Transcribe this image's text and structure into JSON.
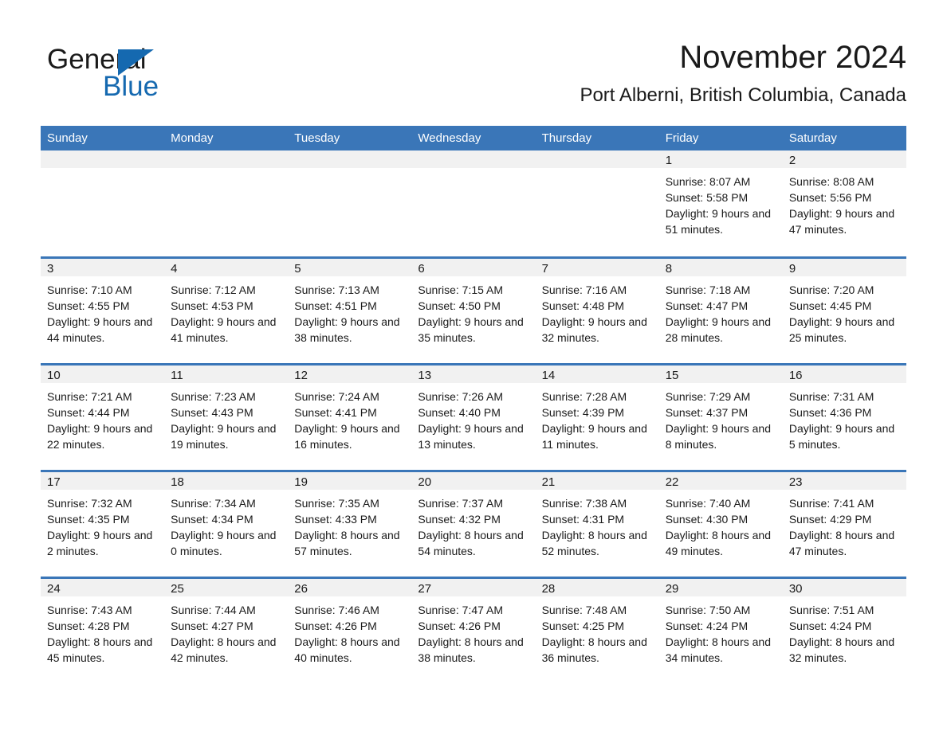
{
  "brand": {
    "word1": "General",
    "word2": "Blue",
    "triangle_color": "#1569b0"
  },
  "header": {
    "title": "November 2024",
    "subtitle": "Port Alberni, British Columbia, Canada"
  },
  "theme": {
    "header_blue": "#3a76b8",
    "daynum_gray": "#f1f1f1",
    "text": "#1a1a1a"
  },
  "weekday_headers": [
    "Sunday",
    "Monday",
    "Tuesday",
    "Wednesday",
    "Thursday",
    "Friday",
    "Saturday"
  ],
  "labels": {
    "sunrise_prefix": "Sunrise:",
    "sunset_prefix": "Sunset:",
    "daylight_prefix": "Daylight:"
  },
  "weeks": [
    [
      {
        "day": "",
        "empty": true
      },
      {
        "day": "",
        "empty": true
      },
      {
        "day": "",
        "empty": true
      },
      {
        "day": "",
        "empty": true
      },
      {
        "day": "",
        "empty": true
      },
      {
        "day": "1",
        "sunrise": "Sunrise: 8:07 AM",
        "sunset": "Sunset: 5:58 PM",
        "daylight": "Daylight: 9 hours and 51 minutes."
      },
      {
        "day": "2",
        "sunrise": "Sunrise: 8:08 AM",
        "sunset": "Sunset: 5:56 PM",
        "daylight": "Daylight: 9 hours and 47 minutes."
      }
    ],
    [
      {
        "day": "3",
        "sunrise": "Sunrise: 7:10 AM",
        "sunset": "Sunset: 4:55 PM",
        "daylight": "Daylight: 9 hours and 44 minutes."
      },
      {
        "day": "4",
        "sunrise": "Sunrise: 7:12 AM",
        "sunset": "Sunset: 4:53 PM",
        "daylight": "Daylight: 9 hours and 41 minutes."
      },
      {
        "day": "5",
        "sunrise": "Sunrise: 7:13 AM",
        "sunset": "Sunset: 4:51 PM",
        "daylight": "Daylight: 9 hours and 38 minutes."
      },
      {
        "day": "6",
        "sunrise": "Sunrise: 7:15 AM",
        "sunset": "Sunset: 4:50 PM",
        "daylight": "Daylight: 9 hours and 35 minutes."
      },
      {
        "day": "7",
        "sunrise": "Sunrise: 7:16 AM",
        "sunset": "Sunset: 4:48 PM",
        "daylight": "Daylight: 9 hours and 32 minutes."
      },
      {
        "day": "8",
        "sunrise": "Sunrise: 7:18 AM",
        "sunset": "Sunset: 4:47 PM",
        "daylight": "Daylight: 9 hours and 28 minutes."
      },
      {
        "day": "9",
        "sunrise": "Sunrise: 7:20 AM",
        "sunset": "Sunset: 4:45 PM",
        "daylight": "Daylight: 9 hours and 25 minutes."
      }
    ],
    [
      {
        "day": "10",
        "sunrise": "Sunrise: 7:21 AM",
        "sunset": "Sunset: 4:44 PM",
        "daylight": "Daylight: 9 hours and 22 minutes."
      },
      {
        "day": "11",
        "sunrise": "Sunrise: 7:23 AM",
        "sunset": "Sunset: 4:43 PM",
        "daylight": "Daylight: 9 hours and 19 minutes."
      },
      {
        "day": "12",
        "sunrise": "Sunrise: 7:24 AM",
        "sunset": "Sunset: 4:41 PM",
        "daylight": "Daylight: 9 hours and 16 minutes."
      },
      {
        "day": "13",
        "sunrise": "Sunrise: 7:26 AM",
        "sunset": "Sunset: 4:40 PM",
        "daylight": "Daylight: 9 hours and 13 minutes."
      },
      {
        "day": "14",
        "sunrise": "Sunrise: 7:28 AM",
        "sunset": "Sunset: 4:39 PM",
        "daylight": "Daylight: 9 hours and 11 minutes."
      },
      {
        "day": "15",
        "sunrise": "Sunrise: 7:29 AM",
        "sunset": "Sunset: 4:37 PM",
        "daylight": "Daylight: 9 hours and 8 minutes."
      },
      {
        "day": "16",
        "sunrise": "Sunrise: 7:31 AM",
        "sunset": "Sunset: 4:36 PM",
        "daylight": "Daylight: 9 hours and 5 minutes."
      }
    ],
    [
      {
        "day": "17",
        "sunrise": "Sunrise: 7:32 AM",
        "sunset": "Sunset: 4:35 PM",
        "daylight": "Daylight: 9 hours and 2 minutes."
      },
      {
        "day": "18",
        "sunrise": "Sunrise: 7:34 AM",
        "sunset": "Sunset: 4:34 PM",
        "daylight": "Daylight: 9 hours and 0 minutes."
      },
      {
        "day": "19",
        "sunrise": "Sunrise: 7:35 AM",
        "sunset": "Sunset: 4:33 PM",
        "daylight": "Daylight: 8 hours and 57 minutes."
      },
      {
        "day": "20",
        "sunrise": "Sunrise: 7:37 AM",
        "sunset": "Sunset: 4:32 PM",
        "daylight": "Daylight: 8 hours and 54 minutes."
      },
      {
        "day": "21",
        "sunrise": "Sunrise: 7:38 AM",
        "sunset": "Sunset: 4:31 PM",
        "daylight": "Daylight: 8 hours and 52 minutes."
      },
      {
        "day": "22",
        "sunrise": "Sunrise: 7:40 AM",
        "sunset": "Sunset: 4:30 PM",
        "daylight": "Daylight: 8 hours and 49 minutes."
      },
      {
        "day": "23",
        "sunrise": "Sunrise: 7:41 AM",
        "sunset": "Sunset: 4:29 PM",
        "daylight": "Daylight: 8 hours and 47 minutes."
      }
    ],
    [
      {
        "day": "24",
        "sunrise": "Sunrise: 7:43 AM",
        "sunset": "Sunset: 4:28 PM",
        "daylight": "Daylight: 8 hours and 45 minutes."
      },
      {
        "day": "25",
        "sunrise": "Sunrise: 7:44 AM",
        "sunset": "Sunset: 4:27 PM",
        "daylight": "Daylight: 8 hours and 42 minutes."
      },
      {
        "day": "26",
        "sunrise": "Sunrise: 7:46 AM",
        "sunset": "Sunset: 4:26 PM",
        "daylight": "Daylight: 8 hours and 40 minutes."
      },
      {
        "day": "27",
        "sunrise": "Sunrise: 7:47 AM",
        "sunset": "Sunset: 4:26 PM",
        "daylight": "Daylight: 8 hours and 38 minutes."
      },
      {
        "day": "28",
        "sunrise": "Sunrise: 7:48 AM",
        "sunset": "Sunset: 4:25 PM",
        "daylight": "Daylight: 8 hours and 36 minutes."
      },
      {
        "day": "29",
        "sunrise": "Sunrise: 7:50 AM",
        "sunset": "Sunset: 4:24 PM",
        "daylight": "Daylight: 8 hours and 34 minutes."
      },
      {
        "day": "30",
        "sunrise": "Sunrise: 7:51 AM",
        "sunset": "Sunset: 4:24 PM",
        "daylight": "Daylight: 8 hours and 32 minutes."
      }
    ]
  ]
}
